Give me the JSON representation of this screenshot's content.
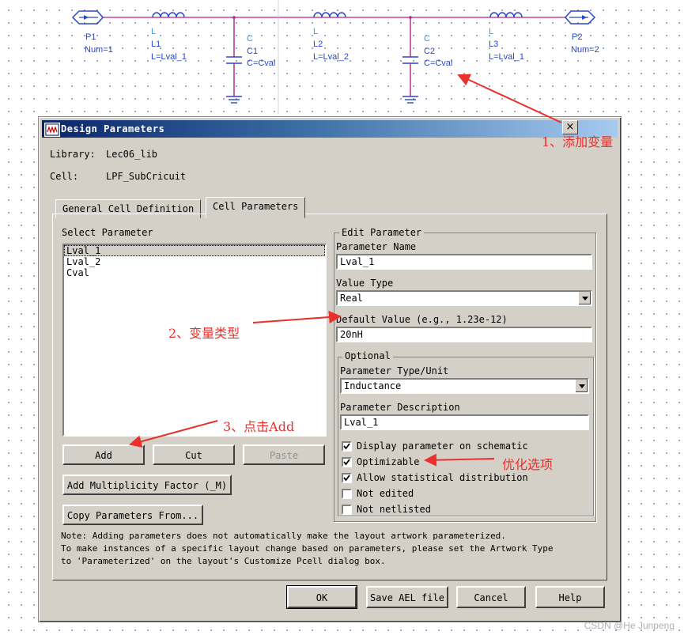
{
  "schematic": {
    "p1": {
      "name": "P1",
      "num": "Num=1"
    },
    "l1": {
      "type": "L",
      "name": "L1",
      "value": "L=Lval_1"
    },
    "c1": {
      "type": "C",
      "name": "C1",
      "value": "C=Cval"
    },
    "l2": {
      "type": "L",
      "name": "L2",
      "value": "L=Lval_2"
    },
    "c2": {
      "type": "C",
      "name": "C2",
      "value": "C=Cval"
    },
    "l3": {
      "type": "L",
      "name": "L3",
      "value": "L=Lval_1"
    },
    "p2": {
      "name": "P2",
      "num": "Num=2"
    }
  },
  "dialog": {
    "title": "Design Parameters",
    "close": "×",
    "library_label": "Library:",
    "library_value": "Lec06_lib",
    "cell_label": "Cell:",
    "cell_value": "LPF_SubCricuit",
    "tabs": [
      {
        "label": "General Cell Definition",
        "active": false
      },
      {
        "label": "Cell Parameters",
        "active": true
      }
    ],
    "select_parameter_label": "Select Parameter",
    "parameters": [
      "Lval_1",
      "Lval_2",
      "Cval"
    ],
    "selected_parameter": "Lval_1",
    "buttons": {
      "add": "Add",
      "cut": "Cut",
      "paste": "Paste",
      "add_multiplicity": "Add Multiplicity Factor (_M)",
      "copy_params": "Copy Parameters From..."
    },
    "edit": {
      "group_title": "Edit Parameter",
      "name_label": "Parameter Name",
      "name_value": "Lval_1",
      "value_type_label": "Value Type",
      "value_type": "Real",
      "default_label": "Default Value (e.g., 1.23e-12)",
      "default_value": "20nH",
      "optional_title": "Optional",
      "type_unit_label": "Parameter Type/Unit",
      "type_unit": "Inductance",
      "desc_label": "Parameter Description",
      "desc_value": "Lval_1",
      "checks": [
        {
          "label": "Display parameter on schematic",
          "checked": true
        },
        {
          "label": "Optimizable",
          "checked": true
        },
        {
          "label": "Allow statistical distribution",
          "checked": true
        },
        {
          "label": "Not edited",
          "checked": false
        },
        {
          "label": "Not netlisted",
          "checked": false
        }
      ]
    },
    "note": [
      "Note: Adding parameters does not automatically make the layout artwork parameterized.",
      "To make instances of a specific layout change based on parameters, please set the Artwork Type",
      "to 'Parameterized' on the layout's Customize Pcell dialog box."
    ],
    "footer": {
      "ok": "OK",
      "save_ael": "Save AEL file",
      "cancel": "Cancel",
      "help": "Help"
    }
  },
  "annotations": {
    "a1": "1、添加变量",
    "a2": "2、变量类型",
    "a3": "3、点击Add",
    "a4": "优化选项"
  },
  "watermark": "CSDN @He Junpeng",
  "colors": {
    "annotation": "#e8302c",
    "wire": "#b0208e",
    "component": "#2a46c8",
    "titlebar": "#0a246a"
  }
}
